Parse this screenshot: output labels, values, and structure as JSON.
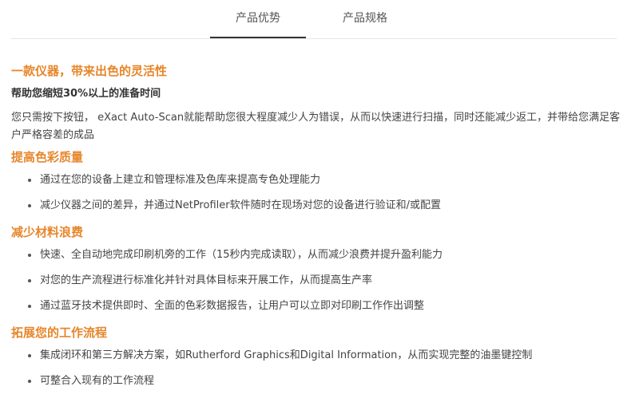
{
  "tabs": [
    {
      "label": "产品优势",
      "active": true
    },
    {
      "label": "产品规格",
      "active": false
    }
  ],
  "accent_color": "#e6862a",
  "sections": [
    {
      "title": "一款仪器，带来出色的灵活性",
      "subtitle": "帮助您缩短30%以上的准备时间",
      "paragraph": "您只需按下按钮， eXact Auto-Scan就能帮助您很大程度减少人为错误，从而以快速进行扫描，同时还能减少返工，并带给您满足客户严格容差的成品"
    },
    {
      "title": "提高色彩质量",
      "items": [
        "通过在您的设备上建立和管理标准及色库来提高专色处理能力",
        "减少仪器之间的差异，并通过NetProfiler软件随时在现场对您的设备进行验证和/或配置"
      ]
    },
    {
      "title": "减少材料浪费",
      "items": [
        "快速、全自动地完成印刷机旁的工作（15秒内完成读取），从而减少浪费并提升盈利能力",
        "对您的生产流程进行标准化并针对具体目标来开展工作，从而提高生产率",
        "通过蓝牙技术提供即时、全面的色彩数据报告，让用户可以立即对印刷工作作出调整"
      ]
    },
    {
      "title": "拓展您的工作流程",
      "items": [
        "集成闭环和第三方解决方案，如Rutherford Graphics和Digital Information，从而实现完整的油墨键控制",
        "可整合入现有的工作流程"
      ]
    }
  ]
}
